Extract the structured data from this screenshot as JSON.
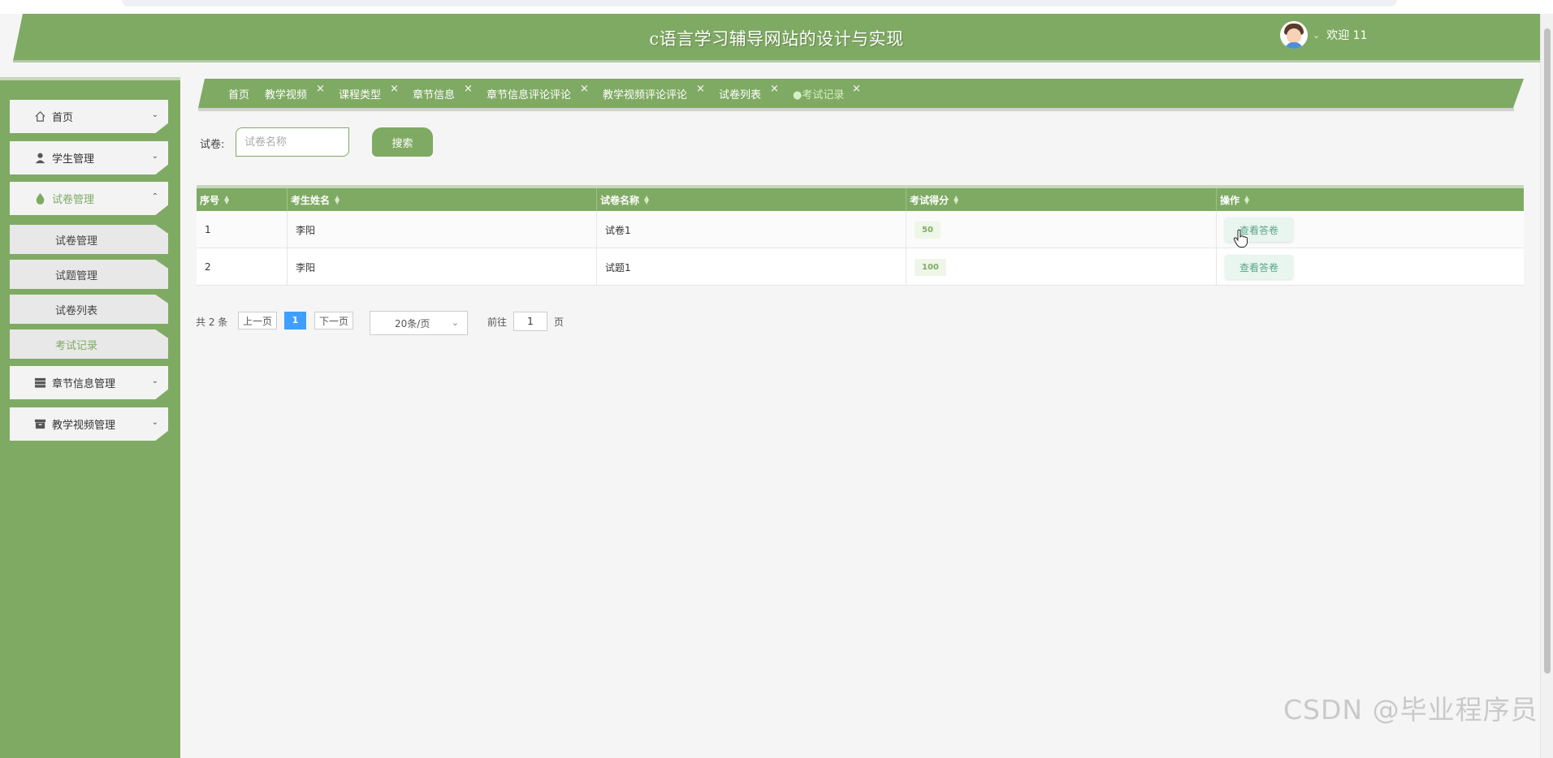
{
  "header": {
    "title": "c语言学习辅导网站的设计与实现",
    "welcome": "欢迎 11"
  },
  "sidebar": {
    "items": [
      {
        "label": "首页",
        "icon": "home-icon"
      },
      {
        "label": "学生管理",
        "icon": "user-icon"
      },
      {
        "label": "试卷管理",
        "icon": "drop-icon",
        "expanded": true
      },
      {
        "label": "章节信息管理",
        "icon": "list-icon"
      },
      {
        "label": "教学视频管理",
        "icon": "archive-icon"
      }
    ],
    "subitems": [
      "试卷管理",
      "试题管理",
      "试卷列表",
      "考试记录"
    ],
    "active_subitem": "考试记录"
  },
  "tabs": [
    "首页",
    "教学视频",
    "课程类型",
    "章节信息",
    "章节信息评论评论",
    "教学视频评论评论",
    "试卷列表",
    "考试记录"
  ],
  "active_tab": "考试记录",
  "search": {
    "label": "试卷:",
    "placeholder": "试卷名称",
    "button": "搜索"
  },
  "table": {
    "headers": [
      "序号",
      "考生姓名",
      "试卷名称",
      "考试得分",
      "操作"
    ],
    "rows": [
      {
        "index": "1",
        "name": "李阳",
        "paper": "试卷1",
        "score": "50",
        "action": "查看答卷"
      },
      {
        "index": "2",
        "name": "李阳",
        "paper": "试题1",
        "score": "100",
        "action": "查看答卷"
      }
    ]
  },
  "pagination": {
    "total": "共 2 条",
    "prev": "上一页",
    "current": "1",
    "next": "下一页",
    "page_size": "20条/页",
    "goto_label": "前往",
    "goto_value": "1",
    "page_unit": "页"
  },
  "watermark": "CSDN @毕业程序员",
  "colors": {
    "primary": "#7faa63",
    "current_page": "#409eff"
  }
}
